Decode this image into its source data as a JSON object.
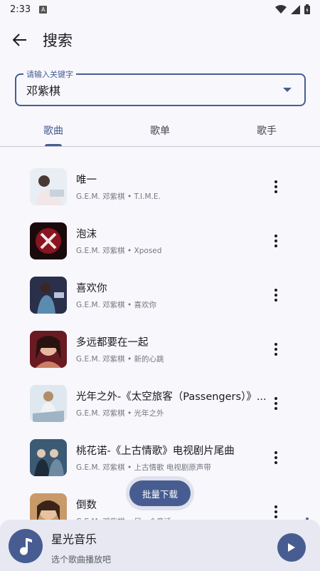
{
  "status": {
    "time": "2:33",
    "notification_icon": "A"
  },
  "app_bar": {
    "title": "搜索"
  },
  "search": {
    "label": "请输入关键字",
    "value": "邓紫棋"
  },
  "tabs": [
    {
      "label": "歌曲",
      "active": true
    },
    {
      "label": "歌单",
      "active": false
    },
    {
      "label": "歌手",
      "active": false
    }
  ],
  "songs": [
    {
      "title": "唯一",
      "subtitle": "G.E.M. 邓紫棋 • T.I.M.E."
    },
    {
      "title": "泡沫",
      "subtitle": "G.E.M. 邓紫棋 • Xposed"
    },
    {
      "title": "喜欢你",
      "subtitle": "G.E.M. 邓紫棋 • 喜欢你"
    },
    {
      "title": "多远都要在一起",
      "subtitle": "G.E.M. 邓紫棋 • 新的心跳"
    },
    {
      "title": "光年之外-《太空旅客（Passengers）》...",
      "subtitle": "G.E.M. 邓紫棋 • 光年之外"
    },
    {
      "title": "桃花诺-《上古情歌》电视剧片尾曲",
      "subtitle": "G.E.M. 邓紫棋 • 上古情歌 电视剧原声带"
    },
    {
      "title": "倒数",
      "subtitle": "G.E.M. 邓紫棋 • 另一个童话"
    }
  ],
  "batch_download": {
    "label": "批量下载"
  },
  "player": {
    "title": "星光音乐",
    "subtitle": "选个歌曲播放吧"
  },
  "colors": {
    "primary": "#475d92",
    "background": "#f8f7fc",
    "player_bg": "#e7e8f1"
  }
}
